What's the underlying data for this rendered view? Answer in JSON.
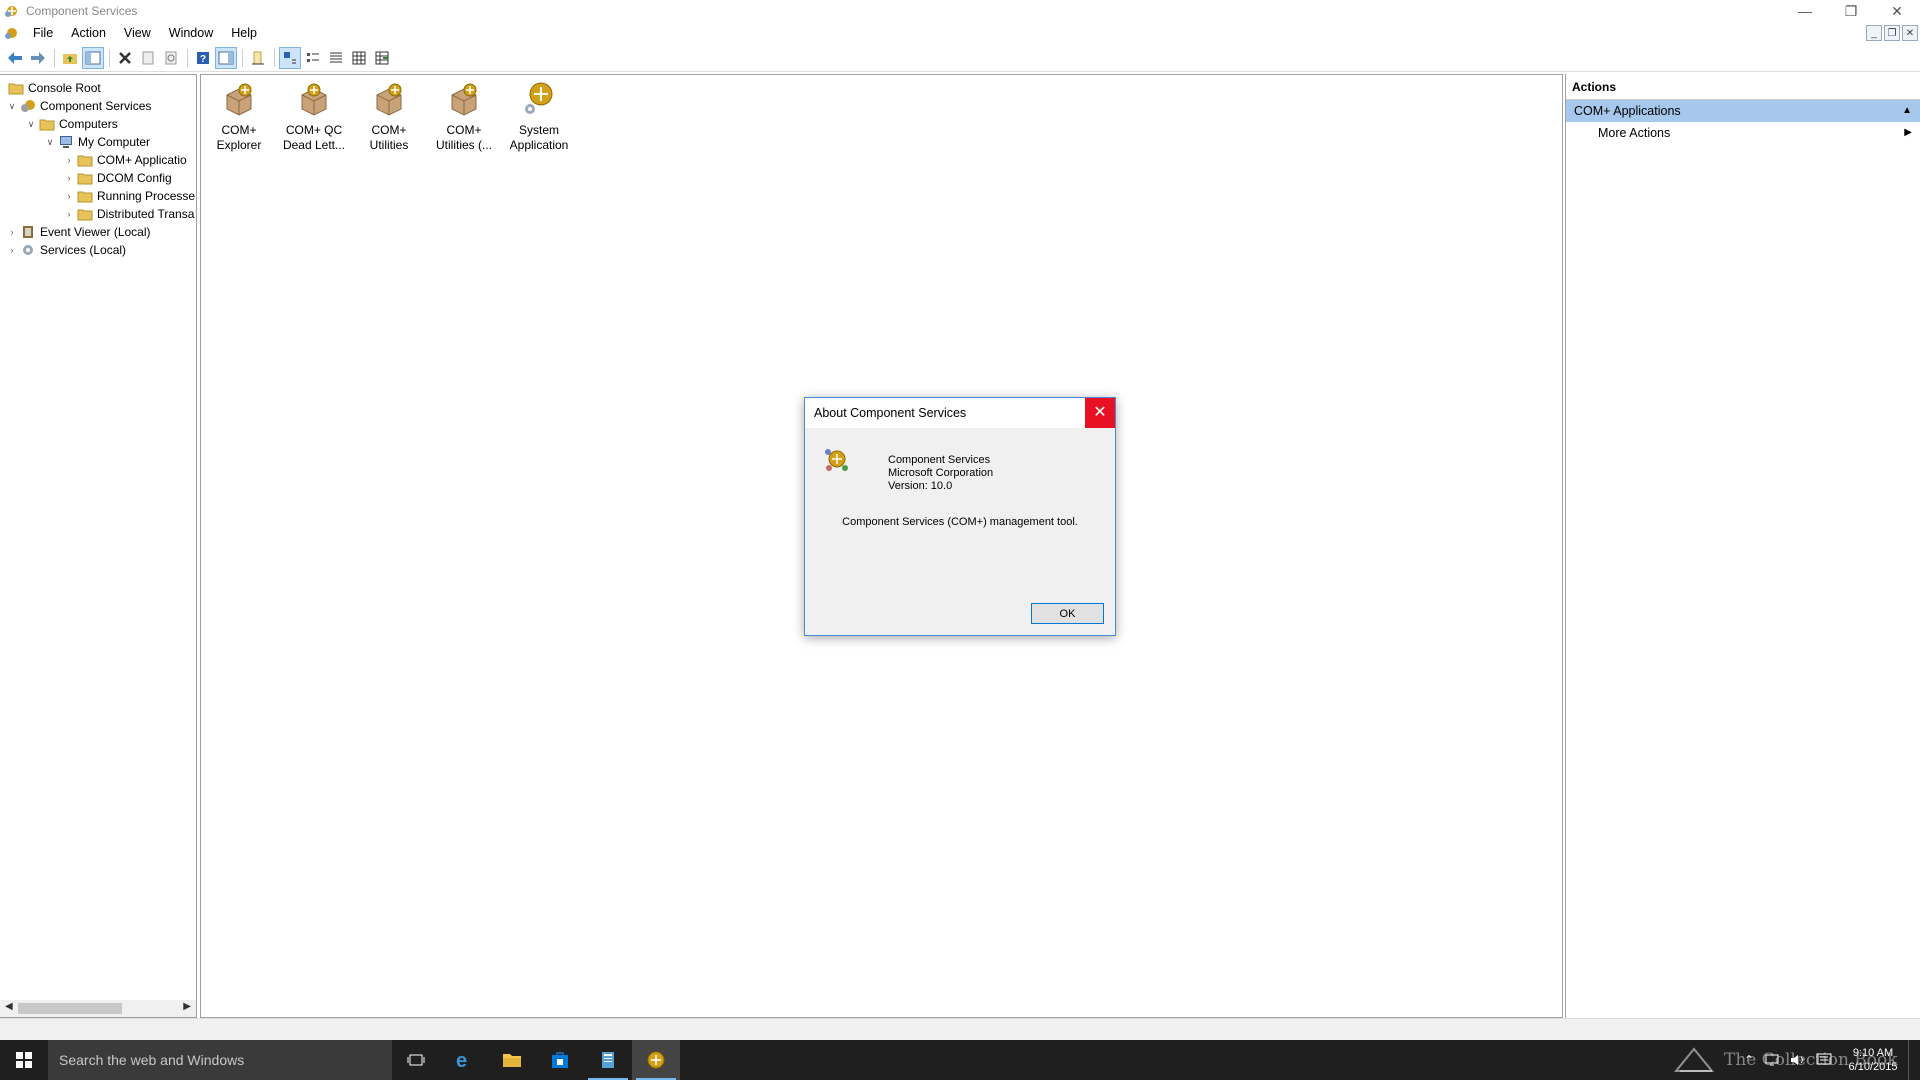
{
  "window": {
    "title": "Component Services"
  },
  "menu": [
    "File",
    "Action",
    "View",
    "Window",
    "Help"
  ],
  "tree": [
    {
      "label": "Console Root"
    },
    {
      "label": "Component Services"
    },
    {
      "label": "Computers"
    },
    {
      "label": "My Computer"
    },
    {
      "label": "COM+ Applicatio"
    },
    {
      "label": "DCOM Config"
    },
    {
      "label": "Running Processe"
    },
    {
      "label": "Distributed Transa"
    },
    {
      "label": "Event Viewer (Local)"
    },
    {
      "label": "Services (Local)"
    }
  ],
  "items": [
    {
      "line1": "COM+",
      "line2": "Explorer"
    },
    {
      "line1": "COM+ QC",
      "line2": "Dead Lett..."
    },
    {
      "line1": "COM+",
      "line2": "Utilities"
    },
    {
      "line1": "COM+",
      "line2": "Utilities (..."
    },
    {
      "line1": "System",
      "line2": "Application"
    }
  ],
  "actions": {
    "header": "Actions",
    "section": "COM+ Applications",
    "items": [
      "More Actions"
    ]
  },
  "dialog": {
    "title": "About Component Services",
    "product": "Component Services",
    "company": "Microsoft Corporation",
    "version": "Version: 10.0",
    "description": "Component Services (COM+) management tool.",
    "ok": "OK"
  },
  "taskbar": {
    "search_placeholder": "Search the web and Windows",
    "time": "9:10 AM",
    "date": "6/10/2015",
    "watermark": "The Collection Book"
  },
  "colors": {
    "accent": "#0078d7",
    "close": "#e81123",
    "selection": "#a6c8ec",
    "taskbar": "#1f1f1f"
  }
}
